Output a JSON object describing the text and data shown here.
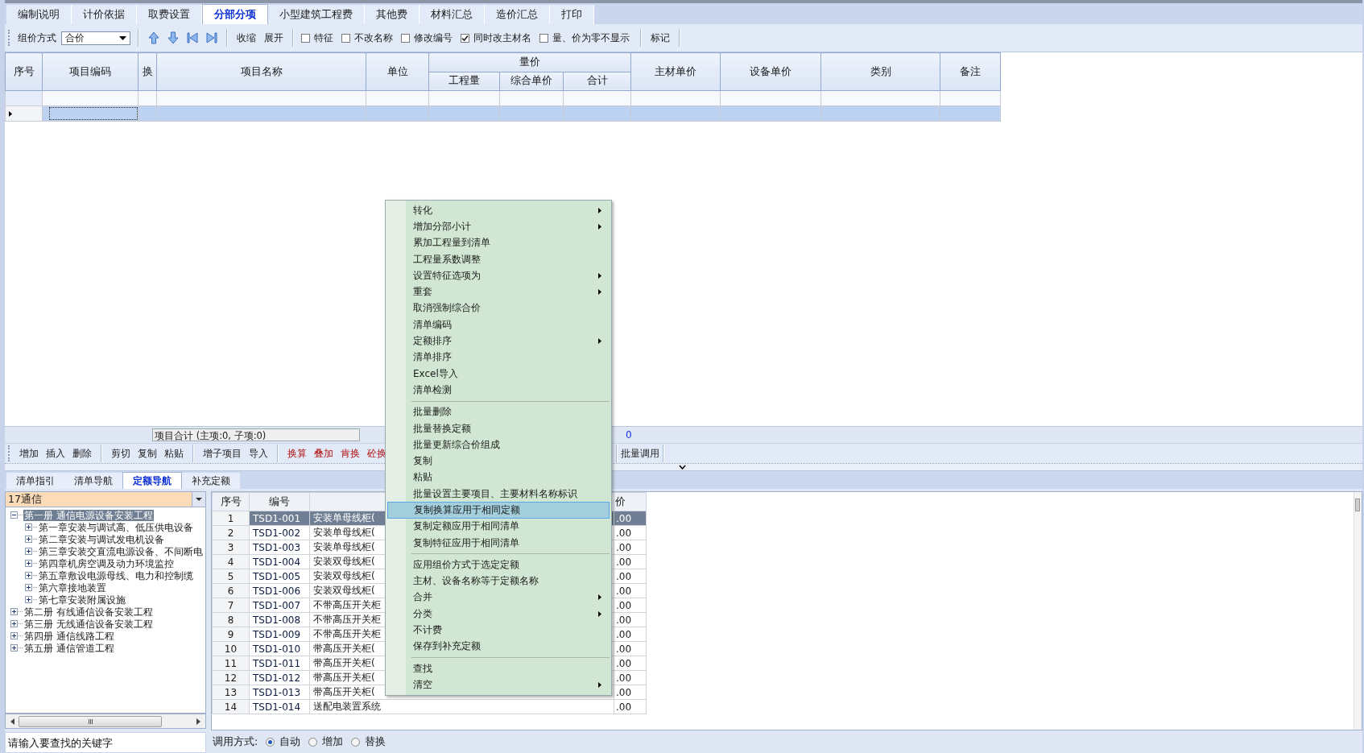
{
  "top_tabs": [
    {
      "label": "编制说明",
      "selected": false
    },
    {
      "label": "计价依据",
      "selected": false
    },
    {
      "label": "取费设置",
      "selected": false
    },
    {
      "label": "分部分项",
      "selected": true
    },
    {
      "label": "小型建筑工程费",
      "selected": false
    },
    {
      "label": "其他费",
      "selected": false
    },
    {
      "label": "材料汇总",
      "selected": false
    },
    {
      "label": "造价汇总",
      "selected": false
    },
    {
      "label": "打印",
      "selected": false
    }
  ],
  "toolbar": {
    "pricing_label": "组价方式",
    "pricing_value": "合价",
    "buttons": [
      "收缩",
      "展开"
    ],
    "options": [
      {
        "label": "特征",
        "checked": false
      },
      {
        "label": "不改名称",
        "checked": false
      },
      {
        "label": "修改编号",
        "checked": false
      },
      {
        "label": "同时改主材名",
        "checked": true
      },
      {
        "label": "量、价为零不显示",
        "checked": false
      }
    ],
    "mark_button": "标记"
  },
  "grid": {
    "columns_before": [
      "序号",
      "项目编码",
      "换",
      "项目名称",
      "单位"
    ],
    "group": {
      "label": "量价",
      "columns": [
        "工程量",
        "综合单价",
        "合计"
      ]
    },
    "columns_after": [
      "主材单价",
      "设备单价",
      "类别",
      "备注"
    ],
    "rows": [
      {
        "selected": false
      },
      {
        "selected": true
      }
    ]
  },
  "status": {
    "summary": "项目合计 (主项:0, 子项:0)",
    "total": "0"
  },
  "edit_toolbar": {
    "groups": [
      [
        {
          "label": "增加",
          "kind": "plain"
        },
        {
          "label": "插入",
          "kind": "plain"
        },
        {
          "label": "删除",
          "kind": "plain"
        }
      ],
      [
        {
          "label": "剪切",
          "kind": "plain"
        },
        {
          "label": "复制",
          "kind": "plain"
        },
        {
          "label": "粘贴",
          "kind": "plain"
        }
      ],
      [
        {
          "label": "增子项目",
          "kind": "plain"
        },
        {
          "label": "导入",
          "kind": "plain"
        }
      ],
      [
        {
          "label": "换算",
          "kind": "conversion"
        },
        {
          "label": "叠加",
          "kind": "conversion"
        },
        {
          "label": "肯换",
          "kind": "conversion"
        },
        {
          "label": "砼换",
          "kind": "conversion"
        }
      ]
    ],
    "batch_button": "批量调用"
  },
  "bottom_tabs": [
    {
      "label": "清单指引",
      "selected": false
    },
    {
      "label": "清单导航",
      "selected": false
    },
    {
      "label": "定额导航",
      "selected": true
    },
    {
      "label": "补充定额",
      "selected": false
    }
  ],
  "library": {
    "value": "17通信"
  },
  "tree": [
    {
      "label": "第一册 通信电源设备安装工程",
      "expanded": true,
      "selected": true,
      "children": [
        {
          "label": "第一章安装与调试高、低压供电设备",
          "expanded": false,
          "selected": false
        },
        {
          "label": "第二章安装与调试发电机设备",
          "expanded": false,
          "selected": false
        },
        {
          "label": "第三章安装交直流电源设备、不间断电",
          "expanded": false,
          "selected": false
        },
        {
          "label": "第四章机房空调及动力环境监控",
          "expanded": false,
          "selected": false
        },
        {
          "label": "第五章敷设电源母线、电力和控制缆",
          "expanded": false,
          "selected": false
        },
        {
          "label": "第六章接地装置",
          "expanded": false,
          "selected": false
        },
        {
          "label": "第七章安装附属设施",
          "expanded": false,
          "selected": false
        }
      ]
    },
    {
      "label": "第二册 有线通信设备安装工程",
      "expanded": false,
      "selected": false
    },
    {
      "label": "第三册 无线通信设备安装工程",
      "expanded": false,
      "selected": false
    },
    {
      "label": "第四册 通信线路工程",
      "expanded": false,
      "selected": false
    },
    {
      "label": "第五册 通信管道工程",
      "expanded": false,
      "selected": false
    }
  ],
  "search": {
    "placeholder": "请输入要查找的关键字"
  },
  "quota_table": {
    "headers": {
      "no": "序号",
      "code": "编号",
      "column_4": "价"
    },
    "rows": [
      {
        "no": "1",
        "code": "TSD1-001",
        "column_3": "安装单母线柜(",
        "column_4": ".00",
        "selected": true
      },
      {
        "no": "2",
        "code": "TSD1-002",
        "column_3": "安装单母线柜(",
        "column_4": ".00",
        "selected": false
      },
      {
        "no": "3",
        "code": "TSD1-003",
        "column_3": "安装单母线柜(",
        "column_4": ".00",
        "selected": false
      },
      {
        "no": "4",
        "code": "TSD1-004",
        "column_3": "安装双母线柜(",
        "column_4": ".00",
        "selected": false
      },
      {
        "no": "5",
        "code": "TSD1-005",
        "column_3": "安装双母线柜(",
        "column_4": ".00",
        "selected": false
      },
      {
        "no": "6",
        "code": "TSD1-006",
        "column_3": "安装双母线柜(",
        "column_4": ".00",
        "selected": false
      },
      {
        "no": "7",
        "code": "TSD1-007",
        "column_3": "不带高压开关柜",
        "column_4": ".00",
        "selected": false
      },
      {
        "no": "8",
        "code": "TSD1-008",
        "column_3": "不带高压开关柜",
        "column_4": ".00",
        "selected": false
      },
      {
        "no": "9",
        "code": "TSD1-009",
        "column_3": "不带高压开关柜",
        "column_4": ".00",
        "selected": false
      },
      {
        "no": "10",
        "code": "TSD1-010",
        "column_3": "带高压开关柜(",
        "column_4": ".00",
        "selected": false
      },
      {
        "no": "11",
        "code": "TSD1-011",
        "column_3": "带高压开关柜(",
        "column_4": ".00",
        "selected": false
      },
      {
        "no": "12",
        "code": "TSD1-012",
        "column_3": "带高压开关柜(",
        "column_4": ".00",
        "selected": false
      },
      {
        "no": "13",
        "code": "TSD1-013",
        "column_3": "带高压开关柜(",
        "column_4": ".00",
        "selected": false
      },
      {
        "no": "14",
        "code": "TSD1-014",
        "column_3": "送配电装置系统",
        "column_4": ".00",
        "selected": false
      }
    ]
  },
  "call_mode": {
    "label": "调用方式:",
    "options": [
      {
        "label": "自动",
        "selected": true
      },
      {
        "label": "增加",
        "selected": false
      },
      {
        "label": "替换",
        "selected": false
      }
    ]
  },
  "context_menu": {
    "items": [
      {
        "kind": "item",
        "label": "转化",
        "submenu": true,
        "selected": false
      },
      {
        "kind": "item",
        "label": "增加分部小计",
        "submenu": true,
        "selected": false
      },
      {
        "kind": "item",
        "label": "累加工程量到清单",
        "submenu": false,
        "selected": false
      },
      {
        "kind": "item",
        "label": "工程量系数调整",
        "submenu": false,
        "selected": false
      },
      {
        "kind": "item",
        "label": "设置特征选项为",
        "submenu": true,
        "selected": false
      },
      {
        "kind": "item",
        "label": "重套",
        "submenu": true,
        "selected": false
      },
      {
        "kind": "item",
        "label": "取消强制综合价",
        "submenu": false,
        "selected": false
      },
      {
        "kind": "item",
        "label": "清单编码",
        "submenu": false,
        "selected": false
      },
      {
        "kind": "item",
        "label": "定额排序",
        "submenu": true,
        "selected": false
      },
      {
        "kind": "item",
        "label": "清单排序",
        "submenu": false,
        "selected": false
      },
      {
        "kind": "item",
        "label": "Excel导入",
        "submenu": false,
        "selected": false
      },
      {
        "kind": "item",
        "label": "清单检测",
        "submenu": false,
        "selected": false
      },
      {
        "kind": "separator"
      },
      {
        "kind": "item",
        "label": "批量删除",
        "submenu": false,
        "selected": false
      },
      {
        "kind": "item",
        "label": "批量替换定额",
        "submenu": false,
        "selected": false
      },
      {
        "kind": "item",
        "label": "批量更新综合价组成",
        "submenu": false,
        "selected": false
      },
      {
        "kind": "item",
        "label": "复制",
        "submenu": false,
        "selected": false
      },
      {
        "kind": "item",
        "label": "粘贴",
        "submenu": false,
        "selected": false
      },
      {
        "kind": "item",
        "label": "批量设置主要项目、主要材料名称标识",
        "submenu": false,
        "selected": false
      },
      {
        "kind": "item",
        "label": "复制换算应用于相同定额",
        "submenu": false,
        "selected": true
      },
      {
        "kind": "item",
        "label": "复制定额应用于相同清单",
        "submenu": false,
        "selected": false
      },
      {
        "kind": "item",
        "label": "复制特征应用于相同清单",
        "submenu": false,
        "selected": false
      },
      {
        "kind": "separator"
      },
      {
        "kind": "item",
        "label": "应用组价方式于选定定额",
        "submenu": false,
        "selected": false
      },
      {
        "kind": "item",
        "label": "主材、设备名称等于定额名称",
        "submenu": false,
        "selected": false
      },
      {
        "kind": "item",
        "label": "合并",
        "submenu": true,
        "selected": false
      },
      {
        "kind": "item",
        "label": "分类",
        "submenu": true,
        "selected": false
      },
      {
        "kind": "item",
        "label": "不计费",
        "submenu": false,
        "selected": false
      },
      {
        "kind": "item",
        "label": "保存到补充定额",
        "submenu": false,
        "selected": false
      },
      {
        "kind": "separator"
      },
      {
        "kind": "item",
        "label": "查找",
        "submenu": false,
        "selected": false
      },
      {
        "kind": "item",
        "label": "清空",
        "submenu": true,
        "selected": false
      }
    ]
  }
}
